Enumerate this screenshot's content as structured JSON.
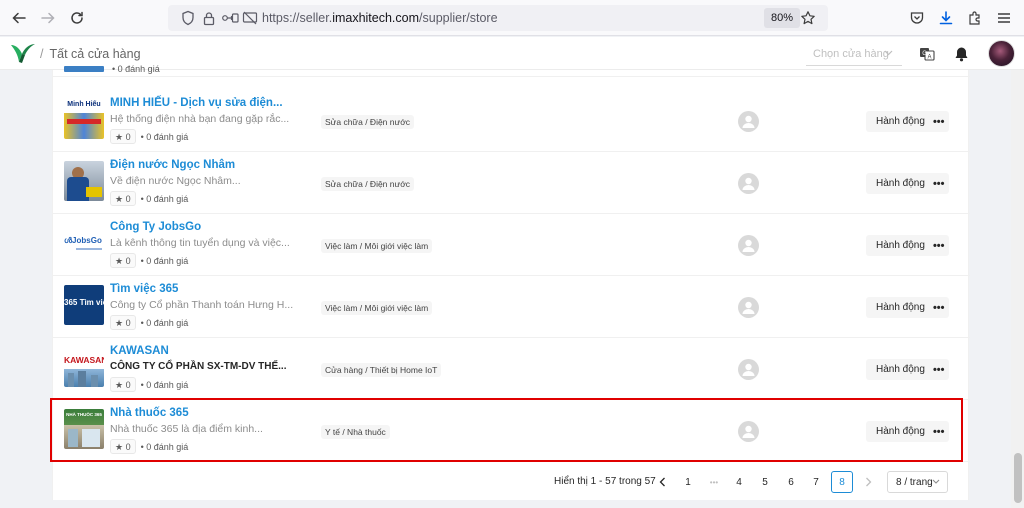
{
  "browser": {
    "url_prefix": "https://seller.",
    "url_domain": "imaxhitech.com",
    "url_path": "/supplier/store",
    "zoom": "80%"
  },
  "header": {
    "breadcrumb": "Tất cả cửa hàng",
    "store_select_placeholder": "Chọn cửa hàng"
  },
  "partial_row": {
    "review_count": "0 đánh giá"
  },
  "stores": [
    {
      "name": "MINH HIẾU - Dịch vụ sửa điện...",
      "description": "Hệ thống điện nhà bạn đang gặp rắc...",
      "rating": "0",
      "reviews": "0 đánh giá",
      "category": "Sửa chữa / Điện nước",
      "thumb_text": "Minh Hiếu",
      "action": "Hành động"
    },
    {
      "name": "Điện nước Ngọc Nhâm",
      "description": "Về điện nước Ngọc Nhâm...",
      "rating": "0",
      "reviews": "0 đánh giá",
      "category": "Sửa chữa / Điện nước",
      "thumb_text": "",
      "action": "Hành động"
    },
    {
      "name": "Công Ty JobsGo",
      "description": "Là kênh thông tin tuyển dụng và việc...",
      "rating": "0",
      "reviews": "0 đánh giá",
      "category": "Việc làm / Môi giới việc làm",
      "thumb_text": "JobsGo",
      "action": "Hành động"
    },
    {
      "name": "Tìm việc 365",
      "description": "Công ty Cổ phần Thanh toán Hưng H...",
      "rating": "0",
      "reviews": "0 đánh giá",
      "category": "Việc làm / Môi giới việc làm",
      "thumb_text": "365 Tìm việ",
      "action": "Hành động"
    },
    {
      "name": "KAWASAN",
      "description": "CÔNG TY CỔ PHẦN SX-TM-DV THẾ...",
      "rating": "0",
      "reviews": "0 đánh giá",
      "category": "Cửa hàng / Thiết bị Home IoT",
      "thumb_text": "KAWASAN",
      "action": "Hành động"
    },
    {
      "name": "Nhà thuốc 365",
      "description": "Nhà thuốc 365 là địa điểm kinh...",
      "rating": "0",
      "reviews": "0 đánh giá",
      "category": "Y tế / Nhà thuốc",
      "thumb_text": "NHÀ THUỐC 365",
      "action": "Hành động"
    }
  ],
  "pagination": {
    "info": "Hiển thị 1 - 57 trong 57",
    "pages": [
      "1",
      "•••",
      "4",
      "5",
      "6",
      "7",
      "8"
    ],
    "current": "8",
    "page_size": "8 / trang"
  },
  "colors": {
    "link": "#1d8cd6",
    "highlight": "#e00000"
  }
}
